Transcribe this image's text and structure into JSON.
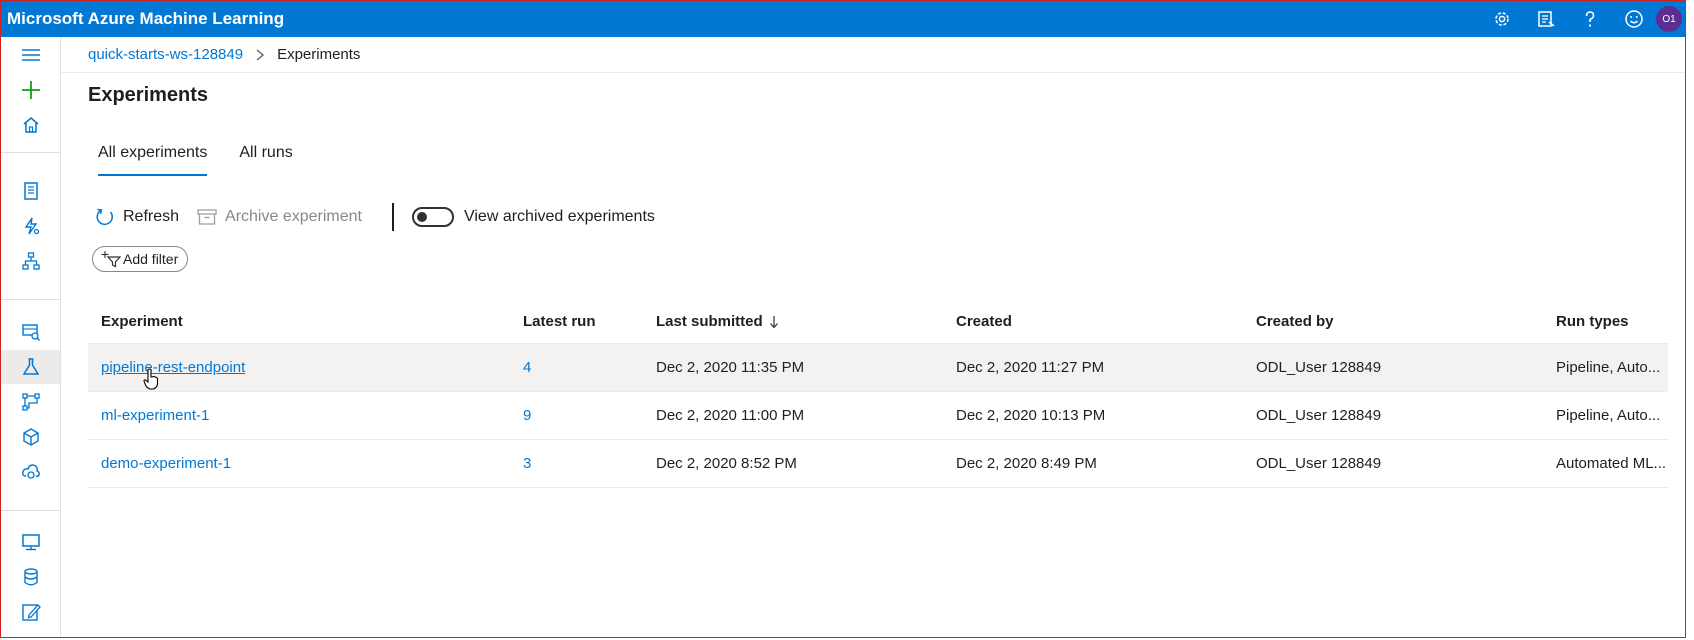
{
  "app": {
    "title": "Microsoft Azure Machine Learning"
  },
  "topbar": {
    "icons": [
      "gear-icon",
      "feedback-list-icon",
      "help-icon",
      "smiley-icon"
    ],
    "avatar_initials": "O1"
  },
  "leftnav": {
    "icons": [
      "hamburger-icon",
      "plus-icon",
      "home-icon",
      "notebook-icon",
      "automl-icon",
      "designer-icon",
      "datasets-icon",
      "experiments-icon",
      "pipelines-icon",
      "models-icon",
      "endpoints-icon",
      "compute-icon",
      "datastores-icon",
      "labeling-icon"
    ],
    "active": "experiments-icon"
  },
  "breadcrumb": {
    "workspace": "quick-starts-ws-128849",
    "current": "Experiments"
  },
  "page": {
    "title": "Experiments"
  },
  "tabs": [
    {
      "label": "All experiments",
      "active": true
    },
    {
      "label": "All runs",
      "active": false
    }
  ],
  "toolbar": {
    "refresh_label": "Refresh",
    "archive_label": "Archive experiment",
    "toggle_label": "View archived experiments",
    "toggle_on": false
  },
  "filter": {
    "add_label": "Add filter"
  },
  "table": {
    "headers": [
      "Experiment",
      "Latest run",
      "Last submitted",
      "Created",
      "Created by",
      "Run types"
    ],
    "sort_column": "Last submitted",
    "rows": [
      {
        "experiment": "pipeline-rest-endpoint",
        "latest_run": "4",
        "last_submitted": "Dec 2, 2020 11:35 PM",
        "created": "Dec 2, 2020 11:27 PM",
        "created_by": "ODL_User 128849",
        "run_types": "Pipeline, Auto..."
      },
      {
        "experiment": "ml-experiment-1",
        "latest_run": "9",
        "last_submitted": "Dec 2, 2020 11:00 PM",
        "created": "Dec 2, 2020 10:13 PM",
        "created_by": "ODL_User 128849",
        "run_types": "Pipeline, Auto..."
      },
      {
        "experiment": "demo-experiment-1",
        "latest_run": "3",
        "last_submitted": "Dec 2, 2020 8:52 PM",
        "created": "Dec 2, 2020 8:49 PM",
        "created_by": "ODL_User 128849",
        "run_types": "Automated ML..."
      }
    ]
  },
  "colors": {
    "accent": "#0078d4",
    "topbar": "#0078d4",
    "plus": "#13a10e",
    "avatar": "#5c2e91"
  }
}
